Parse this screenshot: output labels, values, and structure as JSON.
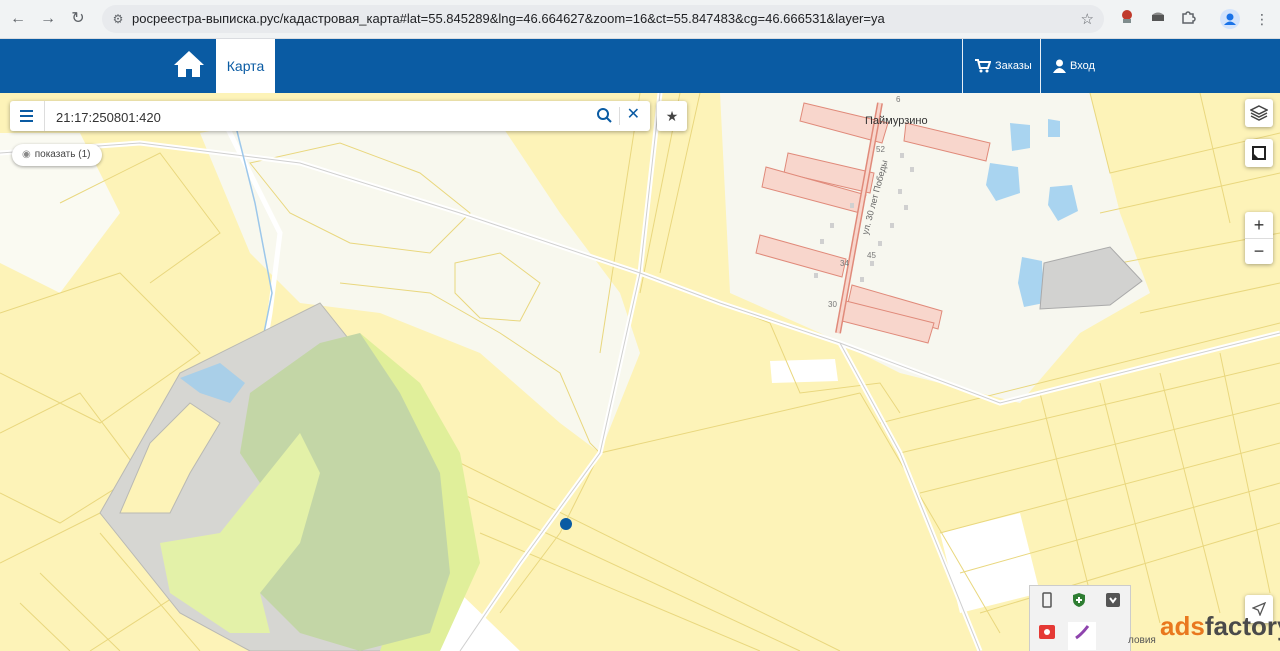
{
  "browser": {
    "url": "росреестра-выписка.рус/кадастровая_карта#lat=55.845289&lng=46.664627&zoom=16&ct=55.847483&cg=46.666531&layer=ya"
  },
  "header": {
    "tab_map": "Карта",
    "orders_label": "Заказы",
    "login_label": "Вход",
    "brand_color": "#0a5ba3"
  },
  "search": {
    "value": "21:17:250801:420"
  },
  "show_button": {
    "label": "показать (1)"
  },
  "map": {
    "place_name": "Паймурзино",
    "street_name": "ул. 30 лет Победы",
    "house_numbers": [
      "6",
      "52",
      "45",
      "34",
      "30"
    ],
    "zoom_in": "+",
    "zoom_out": "−",
    "terms_text": "ловия"
  },
  "watermark": {
    "part1": "ads",
    "part2": "factory"
  }
}
